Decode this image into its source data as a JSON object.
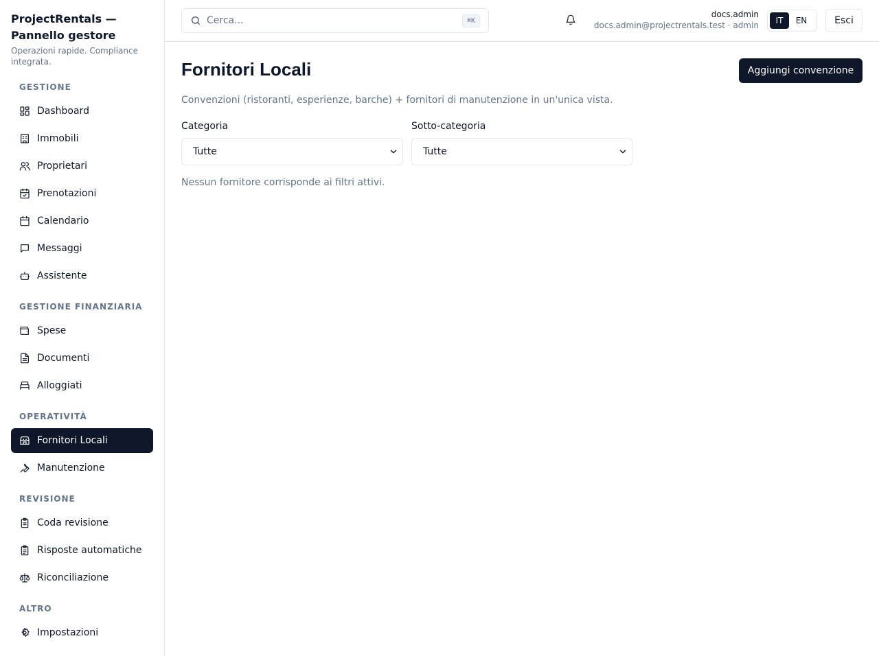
{
  "brand": {
    "title": "ProjectRentals — Pannello gestore",
    "subtitle": "Operazioni rapide. Compliance integrata."
  },
  "sidebar": {
    "sections": [
      {
        "label": "GESTIONE"
      },
      {
        "label": "GESTIONE FINANZIARIA"
      },
      {
        "label": "OPERATIVITÀ"
      },
      {
        "label": "REVISIONE"
      },
      {
        "label": "ALTRO"
      }
    ],
    "items": [
      {
        "label": "Dashboard",
        "icon": "dashboard-icon"
      },
      {
        "label": "Immobili",
        "icon": "building-icon"
      },
      {
        "label": "Proprietari",
        "icon": "users-icon"
      },
      {
        "label": "Prenotazioni",
        "icon": "calendar-check-icon"
      },
      {
        "label": "Calendario",
        "icon": "calendar-icon"
      },
      {
        "label": "Messaggi",
        "icon": "message-icon"
      },
      {
        "label": "Assistente",
        "icon": "bot-icon"
      },
      {
        "label": "Spese",
        "icon": "wallet-icon"
      },
      {
        "label": "Documenti",
        "icon": "file-icon"
      },
      {
        "label": "Alloggiati",
        "icon": "bed-icon"
      },
      {
        "label": "Fornitori Locali",
        "icon": "store-icon",
        "active": true
      },
      {
        "label": "Manutenzione",
        "icon": "wrench-icon"
      },
      {
        "label": "Coda revisione",
        "icon": "clipboard-icon"
      },
      {
        "label": "Risposte automatiche",
        "icon": "clipboard-list-icon"
      },
      {
        "label": "Riconciliazione",
        "icon": "scale-icon"
      },
      {
        "label": "Impostazioni",
        "icon": "gear-icon"
      }
    ]
  },
  "header": {
    "search_placeholder": "Cerca...",
    "search_shortcut": "⌘K",
    "user_name": "docs.admin",
    "user_email_role": "docs.admin@projectrentals.test · admin",
    "lang_it": "IT",
    "lang_en": "EN",
    "lang_active": "IT",
    "logout_label": "Esci"
  },
  "main": {
    "title": "Fornitori Locali",
    "add_button": "Aggiungi convenzione",
    "description": "Convenzioni (ristoranti, esperienze, barche) + fornitori di manutenzione in un'unica vista.",
    "category_label": "Categoria",
    "category_value": "Tutte",
    "subcategory_label": "Sotto-categoria",
    "subcategory_value": "Tutte",
    "empty_message": "Nessun fornitore corrisponde ai filtri attivi."
  },
  "colors": {
    "primary": "#0f172a",
    "muted": "#64748b",
    "border": "#e2e8f0"
  }
}
